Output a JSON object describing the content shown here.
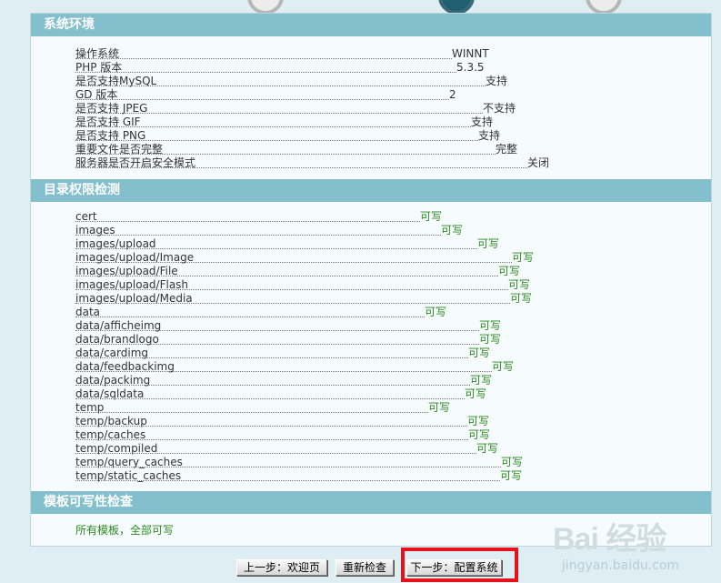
{
  "sections": {
    "env_title": "系统环境",
    "dir_title": "目录权限检测",
    "tpl_title": "模板可写性检查"
  },
  "env_items": [
    {
      "label": "操作系统",
      "value": "WINNT"
    },
    {
      "label": "PHP 版本",
      "value": "5.3.5"
    },
    {
      "label": "是否支持MySQL",
      "value": "支持"
    },
    {
      "label": "GD 版本",
      "value": "2"
    },
    {
      "label": "是否支持 JPEG",
      "value": "不支持"
    },
    {
      "label": "是否支持 GIF",
      "value": "支持"
    },
    {
      "label": "是否支持 PNG",
      "value": "支持"
    },
    {
      "label": "重要文件是否完整",
      "value": "完整"
    },
    {
      "label": "服务器是否开启安全模式",
      "value": "关闭"
    }
  ],
  "dir_items": [
    {
      "label": "cert",
      "value": "可写"
    },
    {
      "label": "images",
      "value": "可写"
    },
    {
      "label": "images/upload",
      "value": "可写"
    },
    {
      "label": "images/upload/Image",
      "value": "可写"
    },
    {
      "label": "images/upload/File",
      "value": "可写"
    },
    {
      "label": "images/upload/Flash",
      "value": "可写"
    },
    {
      "label": "images/upload/Media",
      "value": "可写"
    },
    {
      "label": "data",
      "value": "可写"
    },
    {
      "label": "data/afficheimg",
      "value": "可写"
    },
    {
      "label": "data/brandlogo",
      "value": "可写"
    },
    {
      "label": "data/cardimg",
      "value": "可写"
    },
    {
      "label": "data/feedbackimg",
      "value": "可写"
    },
    {
      "label": "data/packimg",
      "value": "可写"
    },
    {
      "label": "data/sqldata",
      "value": "可写"
    },
    {
      "label": "temp",
      "value": "可写"
    },
    {
      "label": "temp/backup",
      "value": "可写"
    },
    {
      "label": "temp/caches",
      "value": "可写"
    },
    {
      "label": "temp/compiled",
      "value": "可写"
    },
    {
      "label": "temp/query_caches",
      "value": "可写"
    },
    {
      "label": "temp/static_caches",
      "value": "可写"
    }
  ],
  "template_check": "所有模板，全部可写",
  "buttons": {
    "prev": "上一步：欢迎页",
    "recheck": "重新检查",
    "next": "下一步：配置系统"
  },
  "watermark": {
    "brand": "Bai 经验",
    "site": "jingyan.baidu.com"
  },
  "colors": {
    "header": "#83bfcc",
    "ok_text": "#2c8a1e",
    "highlight": "#e8101a"
  }
}
